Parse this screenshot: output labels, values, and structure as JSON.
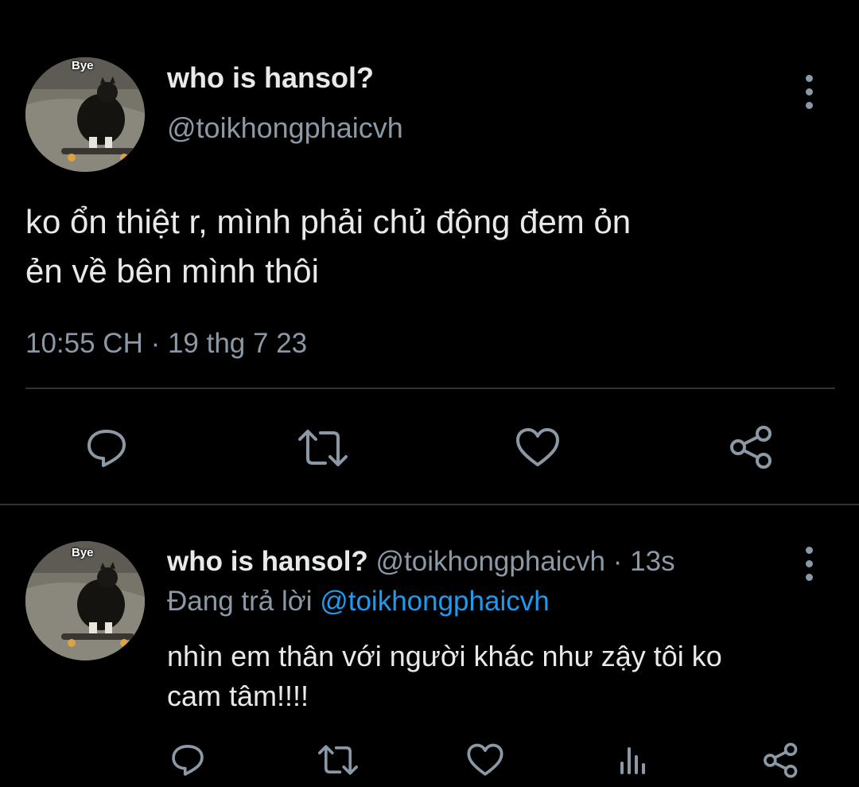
{
  "main_tweet": {
    "avatar_caption": "Bye",
    "display_name": "who is hansol?",
    "handle": "@toikhongphaicvh",
    "text_line1": "ko ổn thiệt r, mình phải chủ động đem ỏn",
    "text_line2": "ẻn về bên mình thôi",
    "timestamp": "10:55 CH · 19 thg 7 23",
    "actions": [
      "reply-icon",
      "retweet-icon",
      "like-icon",
      "share-icon"
    ]
  },
  "reply_tweet": {
    "avatar_caption": "Bye",
    "display_name": "who is hansol?",
    "handle": "@toikhongphaicvh",
    "time_sep": "·",
    "time_ago": "13s",
    "replying_prefix": "Đang trả lời",
    "replying_to": "@toikhongphaicvh",
    "text_line1": "nhìn em thân với người khác như zậy tôi ko",
    "text_line2": "cam tâm!!!!",
    "actions": [
      "reply-icon",
      "retweet-icon",
      "like-icon",
      "views-icon",
      "share-icon"
    ]
  },
  "colors": {
    "background": "#000000",
    "text": "#e7e9ea",
    "secondary": "#8b98a5",
    "link": "#1d9bf0",
    "divider": "#2f3336"
  }
}
